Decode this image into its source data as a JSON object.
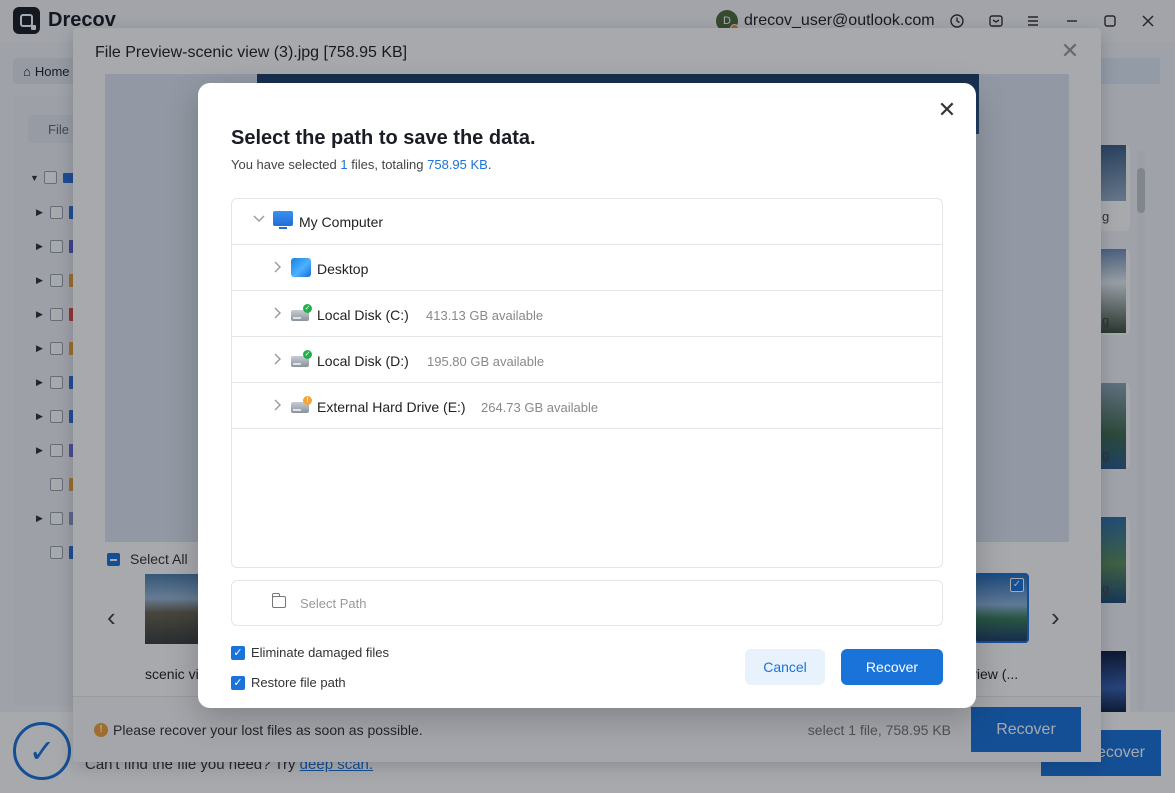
{
  "app": {
    "name": "Drecov",
    "user_initial": "D",
    "user_email": "drecov_user@outlook.com",
    "titlebar_icons": [
      "history-icon",
      "feedback-icon",
      "menu-icon",
      "minimize-icon",
      "maximize-icon",
      "close-icon"
    ]
  },
  "nav": {
    "home_label": "Home"
  },
  "left_panel": {
    "file_tab_label": "File"
  },
  "bottom": {
    "cant_find_text": "Can't find the file you need? Try",
    "deep_scan_link": "deep scan.",
    "recover_label": "Recover"
  },
  "right_list": {
    "label_suffix": "g"
  },
  "preview": {
    "title": "File Preview-scenic view (3).jpg [758.95 KB]",
    "select_all_label": "Select All",
    "thumb_left_label": "scenic vie",
    "thumb_right_label": "c view (...",
    "warning_text": "Please recover your lost files as soon as possible.",
    "select_info": "select 1 file, 758.95 KB",
    "recover_label": "Recover"
  },
  "modal": {
    "title": "Select the path to save the data.",
    "subtitle_prefix": "You have selected ",
    "selected_count": "1",
    "subtitle_mid": " files, totaling ",
    "total_size": "758.95 KB",
    "subtitle_suffix": ".",
    "tree": {
      "root": "My Computer",
      "items": [
        {
          "name": "Desktop",
          "available": ""
        },
        {
          "name": "Local Disk (C:)",
          "available": "413.13 GB available"
        },
        {
          "name": "Local Disk (D:)",
          "available": "195.80 GB available"
        },
        {
          "name": "External Hard Drive (E:)",
          "available": "264.73 GB available"
        }
      ]
    },
    "select_path_placeholder": "Select Path",
    "option_eliminate": "Eliminate damaged files",
    "option_restore": "Restore file path",
    "cancel_label": "Cancel",
    "recover_label": "Recover"
  },
  "colors": {
    "accent": "#1a73d9",
    "warning": "#f2a33a",
    "disk_ok": "#22b04b"
  }
}
